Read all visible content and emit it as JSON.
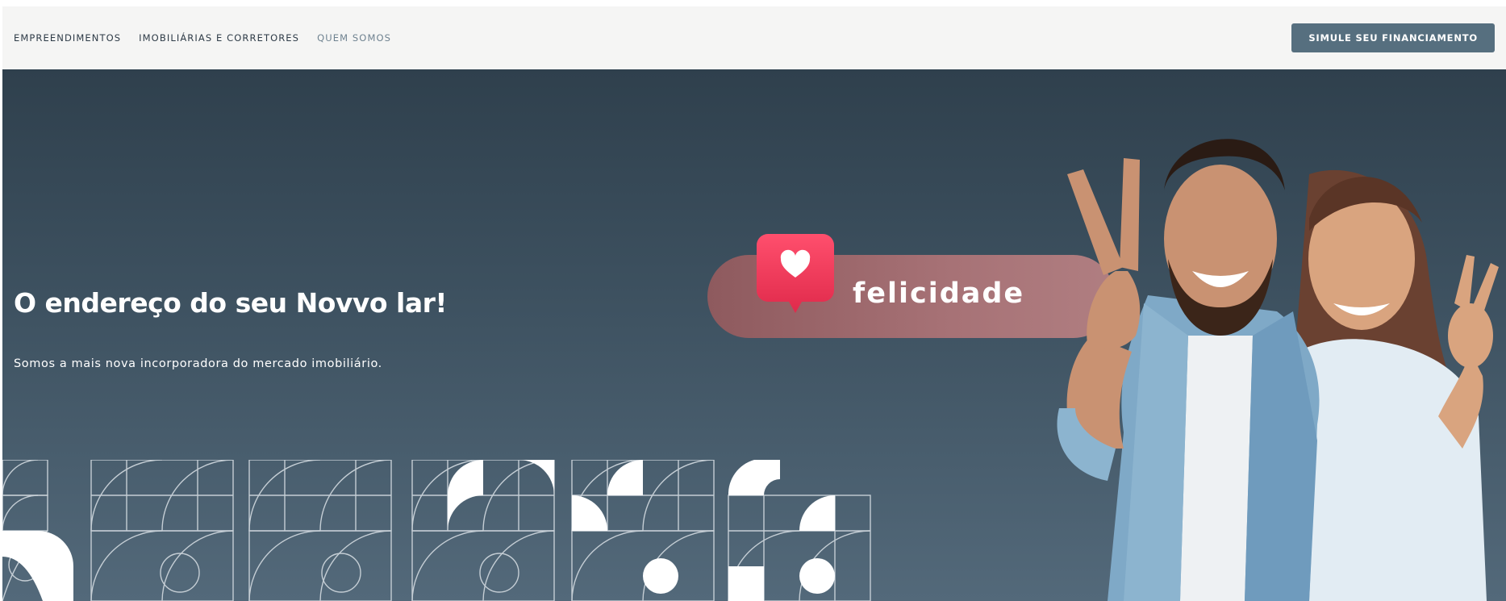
{
  "header": {
    "nav": [
      {
        "label": "EMPREENDIMENTOS"
      },
      {
        "label": "IMOBILIÁRIAS E CORRETORES"
      },
      {
        "label": "QUEM SOMOS"
      }
    ],
    "cta_label": "SIMULE SEU FINANCIAMENTO"
  },
  "hero": {
    "title": "O endereço do seu Novvo lar!",
    "subtitle": "Somos a mais nova incorporadora do mercado imobiliário.",
    "badge_text": "felicidade",
    "badge_icon": "heart-chat-icon",
    "image_alt_icon": "couple-photo"
  },
  "colors": {
    "header_bg": "#f5f5f4",
    "cta_bg": "#566f7f",
    "hero_top": "#2f404d",
    "hero_bottom": "#53697a",
    "badge_pink": "#f0405f"
  }
}
